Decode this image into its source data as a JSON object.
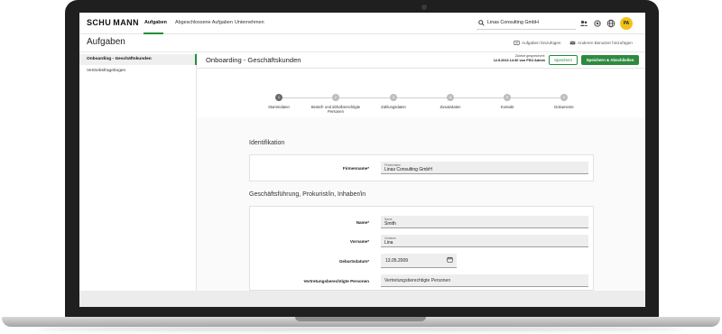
{
  "nav": {
    "brand": "SCHU MANN",
    "links": [
      "Aufgaben",
      "Abgeschlossene Aufgaben",
      "Unternehmen"
    ],
    "search_value": "Linas Consulting GmbH",
    "icons": [
      "users-icon",
      "gear-icon",
      "globe-icon"
    ],
    "avatar": "PA"
  },
  "header": {
    "title": "Aufgaben",
    "action_add_task": "Aufgaben hinzufügen",
    "action_add_user": "Anderen Benutzer hinzufügen"
  },
  "sidebar": {
    "items": [
      {
        "label": "Onboarding - Geschäftskunden",
        "active": true
      },
      {
        "label": "Vertriebsfragebogen",
        "active": false
      }
    ]
  },
  "content": {
    "title": "Onboarding - Geschäftskunden",
    "saved_line1": "Zuletzt gespeichert:",
    "saved_line2": "12.5.2023 14:30 von PSO Admin",
    "save_label": "Speichern",
    "save_close_label": "Speichern & Abschließen"
  },
  "stepper": {
    "steps": [
      {
        "num": "1",
        "label": "Stammdaten",
        "active": true
      },
      {
        "num": "2",
        "label": "Bestell- und abholberechtigte Personen",
        "active": false
      },
      {
        "num": "3",
        "label": "Zahlungsdaten",
        "active": false
      },
      {
        "num": "4",
        "label": "Zusatzdaten",
        "active": false
      },
      {
        "num": "5",
        "label": "Kontakt",
        "active": false
      },
      {
        "num": "6",
        "label": "Dokumente",
        "active": false
      }
    ]
  },
  "identification": {
    "title": "Identifikation",
    "firma_label": "Firmenname*",
    "firma_small": "Firmenname",
    "firma_value": "Linas Consulting GmbH"
  },
  "management": {
    "title": "Geschäftsführung, Prokurist/in, Inhaber/in",
    "name_label": "Name*",
    "name_small": "Name",
    "name_value": "Smith",
    "vorname_label": "Vorname*",
    "vorname_small": "Vorname",
    "vorname_value": "Lina",
    "birth_label": "Geburtsdatum*",
    "birth_value": "13.05.2009",
    "rep_label": "Vertretungsberechtigte Personen",
    "rep_value": "Vertretungsberechtigte Personen"
  },
  "colors": {
    "accent": "#1f8f3a",
    "avatar": "#f3c21a"
  }
}
